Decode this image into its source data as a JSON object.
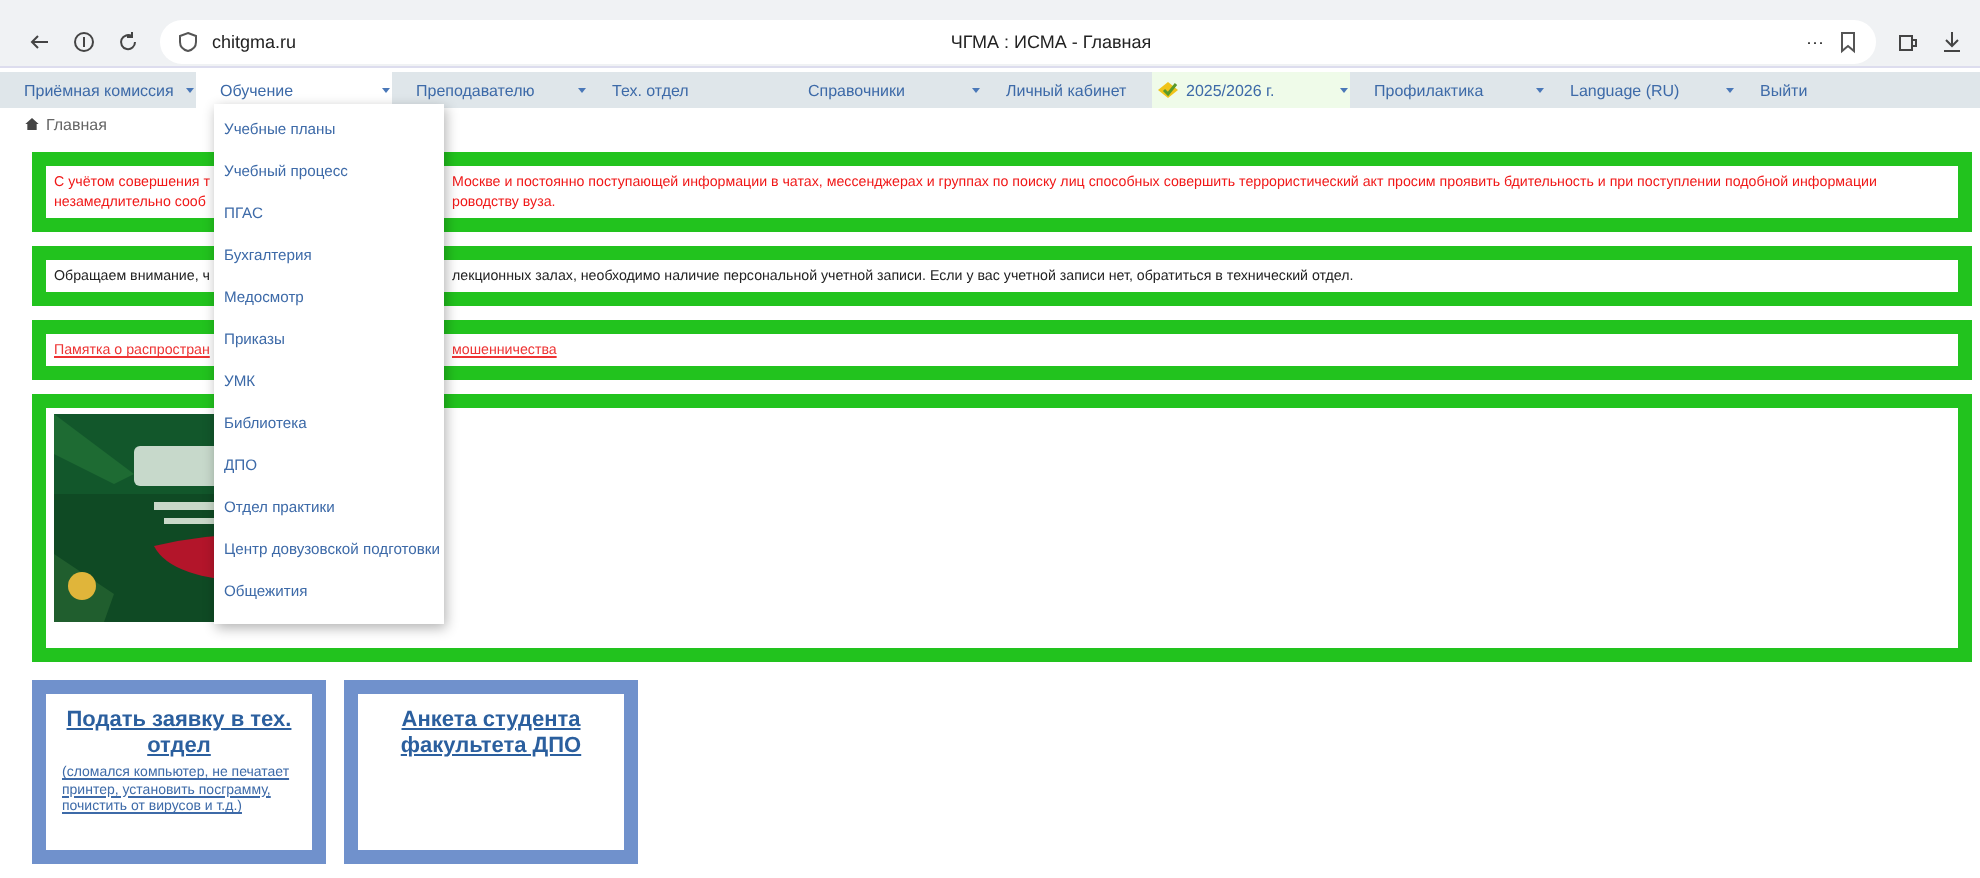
{
  "browser": {
    "url": "chitgma.ru",
    "title": "ЧГМА : ИСМА - Главная",
    "more": "···"
  },
  "nav": [
    {
      "label": "Приёмная комиссия",
      "selected": false,
      "dropdown": true,
      "kind": "plain"
    },
    {
      "label": "Обучение",
      "selected": true,
      "dropdown": true,
      "kind": "plain"
    },
    {
      "label": "Преподавателю",
      "selected": false,
      "dropdown": true,
      "kind": "plain"
    },
    {
      "label": "Тех. отдел",
      "selected": false,
      "dropdown": false,
      "kind": "plain"
    },
    {
      "label": "Справочники",
      "selected": false,
      "dropdown": true,
      "kind": "plain"
    },
    {
      "label": "Личный кабинет",
      "selected": false,
      "dropdown": false,
      "kind": "plain"
    },
    {
      "label": "2025/2026 г.",
      "selected": false,
      "dropdown": true,
      "kind": "year"
    },
    {
      "label": "Профилактика",
      "selected": false,
      "dropdown": true,
      "kind": "plain"
    },
    {
      "label": "Language (RU)",
      "selected": false,
      "dropdown": true,
      "kind": "plain"
    },
    {
      "label": "Выйти",
      "selected": false,
      "dropdown": false,
      "kind": "plain"
    }
  ],
  "breadcrumb": "Главная",
  "menu": [
    "Учебные планы",
    "Учебный процесс",
    "ПГАС",
    "Бухгалтерия",
    "Медосмотр",
    "Приказы",
    "УМК",
    "Библиотека",
    "ДПО",
    "Отдел практики",
    "Центр довузовской подготовки",
    "Общежития"
  ],
  "notices": [
    {
      "kind": "warning",
      "lines": [
        {
          "left": "С учётом совершения т",
          "right": "Москве и постоянно поступающей информации в чатах, мессенджерах и группах по поиску лиц способных совершить террористический акт просим проявить бдительность и при поступлении подобной информации"
        },
        {
          "left": "незамедлительно сооб",
          "right": "роводству вуза."
        }
      ]
    },
    {
      "kind": "info",
      "lines": [
        {
          "left": "Обращаем внимание, ч",
          "right": "лекционных залах, необходимо наличие персональной учетной записи. Если у вас учетной записи нет, обратиться в технический отдел."
        }
      ]
    },
    {
      "kind": "link",
      "lines": [
        {
          "left": "Памятка о распростран",
          "right": "мошенничества"
        }
      ]
    }
  ],
  "cards": [
    {
      "title": "Подать заявку в тех. отдел",
      "note": "(сломался компьютер, не печатает принтер, установить посграмму, почистить от вирусов и т.д.)"
    },
    {
      "title": "Анкета студента факультета ДПО"
    }
  ]
}
